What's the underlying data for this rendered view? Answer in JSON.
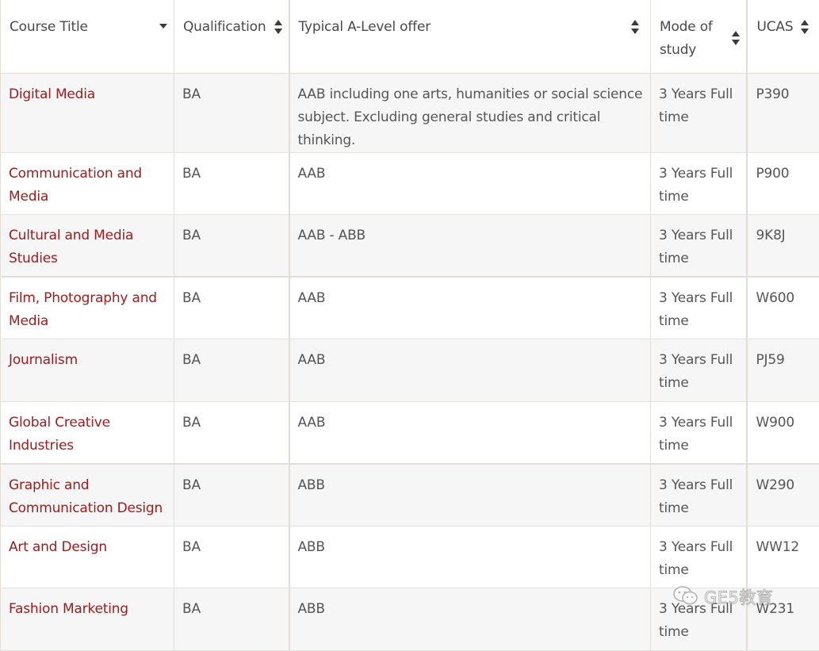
{
  "table": {
    "headers": {
      "course_title": "Course Title",
      "qualification": "Qualification",
      "a_level": "Typical A-Level offer",
      "mode": "Mode of study",
      "ucas": "UCAS"
    },
    "rows": [
      {
        "course": "Digital Media",
        "qualification": "BA",
        "offer": "AAB including one arts, humanities or social science subject. Excluding general studies and critical thinking.",
        "mode": "3 Years Full time",
        "ucas": "P390"
      },
      {
        "course": "Communication and Media",
        "qualification": "BA",
        "offer": "AAB",
        "mode": "3 Years Full time",
        "ucas": "P900"
      },
      {
        "course": "Cultural and Media Studies",
        "qualification": "BA",
        "offer": "AAB - ABB",
        "mode": "3 Years Full time",
        "ucas": "9K8J"
      },
      {
        "course": "Film, Photography and Media",
        "qualification": "BA",
        "offer": "AAB",
        "mode": "3 Years Full time",
        "ucas": "W600"
      },
      {
        "course": "Journalism",
        "qualification": "BA",
        "offer": "AAB",
        "mode": "3 Years Full time",
        "ucas": "PJ59"
      },
      {
        "course": "Global Creative Industries",
        "qualification": "BA",
        "offer": "AAB",
        "mode": "3 Years Full time",
        "ucas": "W900"
      },
      {
        "course": "Graphic and Communication Design",
        "qualification": "BA",
        "offer": "ABB",
        "mode": "3 Years Full time",
        "ucas": "W290"
      },
      {
        "course": "Art and Design",
        "qualification": "BA",
        "offer": "ABB",
        "mode": "3 Years Full time",
        "ucas": "WW12"
      },
      {
        "course": "Fashion Marketing",
        "qualification": "BA",
        "offer": "ABB",
        "mode": "3 Years Full time",
        "ucas": "W231"
      }
    ]
  },
  "watermark": {
    "text": "GE5教育",
    "icon": "wechat-icon"
  },
  "colors": {
    "link": "#a01c1c",
    "text": "#555555",
    "row_alt": "#f6f6f6",
    "border": "#e3ddd8"
  }
}
